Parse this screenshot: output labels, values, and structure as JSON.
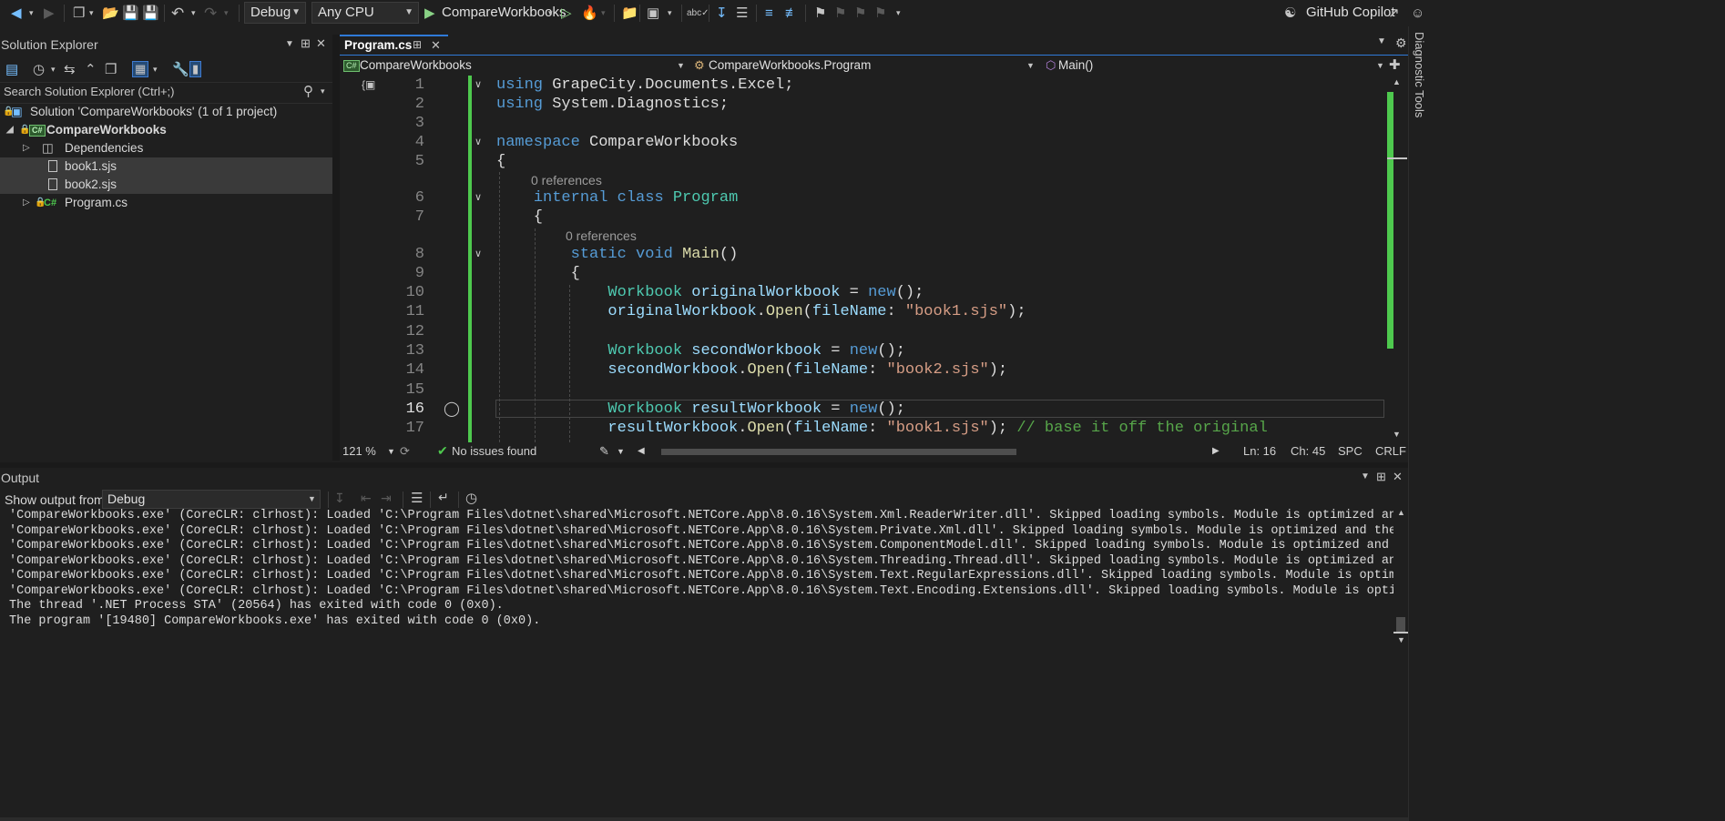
{
  "toolbar": {
    "config_label": "Debug",
    "platform_label": "Any CPU",
    "run_label": "CompareWorkbooks",
    "copilot_label": "GitHub Copilot"
  },
  "solution_explorer": {
    "title": "Solution Explorer",
    "search_placeholder": "Search Solution Explorer (Ctrl+;)",
    "items": [
      {
        "label": "Solution 'CompareWorkbooks' (1 of 1 project)"
      },
      {
        "label": "CompareWorkbooks",
        "badge": "C#"
      },
      {
        "label": "Dependencies"
      },
      {
        "label": "book1.sjs"
      },
      {
        "label": "book2.sjs"
      },
      {
        "label": "Program.cs",
        "badge": "C#"
      }
    ]
  },
  "editor": {
    "tab_label": "Program.cs",
    "nav": {
      "project": "CompareWorkbooks",
      "type": "CompareWorkbooks.Program",
      "member": "Main()"
    },
    "references_label": "0 references",
    "lines": [
      {
        "n": "1"
      },
      {
        "n": "2"
      },
      {
        "n": "3"
      },
      {
        "n": "4"
      },
      {
        "n": "5"
      },
      {
        "n": "6"
      },
      {
        "n": "7"
      },
      {
        "n": "8"
      },
      {
        "n": "9"
      },
      {
        "n": "10"
      },
      {
        "n": "11"
      },
      {
        "n": "12"
      },
      {
        "n": "13"
      },
      {
        "n": "14"
      },
      {
        "n": "15"
      },
      {
        "n": "16"
      },
      {
        "n": "17"
      }
    ],
    "status": {
      "zoom": "121 %",
      "issues": "No issues found",
      "line": "Ln: 16",
      "char": "Ch: 45",
      "whitespace": "SPC",
      "line_ending": "CRLF"
    }
  },
  "output": {
    "title": "Output",
    "show_from_label": "Show output from:",
    "show_from_value": "Debug",
    "lines": [
      "'CompareWorkbooks.exe' (CoreCLR: clrhost): Loaded 'C:\\Program Files\\dotnet\\shared\\Microsoft.NETCore.App\\8.0.16\\System.Xml.ReaderWriter.dll'. Skipped loading symbols. Module is optimized and the debugger option 'Just My Code' is e",
      "'CompareWorkbooks.exe' (CoreCLR: clrhost): Loaded 'C:\\Program Files\\dotnet\\shared\\Microsoft.NETCore.App\\8.0.16\\System.Private.Xml.dll'. Skipped loading symbols. Module is optimized and the debugger option 'Just My Code' is enable",
      "'CompareWorkbooks.exe' (CoreCLR: clrhost): Loaded 'C:\\Program Files\\dotnet\\shared\\Microsoft.NETCore.App\\8.0.16\\System.ComponentModel.dll'. Skipped loading symbols. Module is optimized and the debugger option 'Just My Code' is ena",
      "'CompareWorkbooks.exe' (CoreCLR: clrhost): Loaded 'C:\\Program Files\\dotnet\\shared\\Microsoft.NETCore.App\\8.0.16\\System.Threading.Thread.dll'. Skipped loading symbols. Module is optimized and the debugger option 'Just My Code' is e",
      "'CompareWorkbooks.exe' (CoreCLR: clrhost): Loaded 'C:\\Program Files\\dotnet\\shared\\Microsoft.NETCore.App\\8.0.16\\System.Text.RegularExpressions.dll'. Skipped loading symbols. Module is optimized and the debugger option 'Just My Cod",
      "'CompareWorkbooks.exe' (CoreCLR: clrhost): Loaded 'C:\\Program Files\\dotnet\\shared\\Microsoft.NETCore.App\\8.0.16\\System.Text.Encoding.Extensions.dll'. Skipped loading symbols. Module is optimized and the debugger option 'Just My Co",
      "The thread '.NET Process STA' (20564) has exited with code 0 (0x0).",
      "The program '[19480] CompareWorkbooks.exe' has exited with code 0 (0x0)."
    ]
  },
  "right_strip": {
    "diagnostic_tools_label": "Diagnostic Tools"
  },
  "colors": {
    "accent": "#2f7ad8",
    "change_bar": "#4ec94e",
    "keyword": "#569cd6",
    "type": "#4ec9b0",
    "string": "#d69d85"
  }
}
